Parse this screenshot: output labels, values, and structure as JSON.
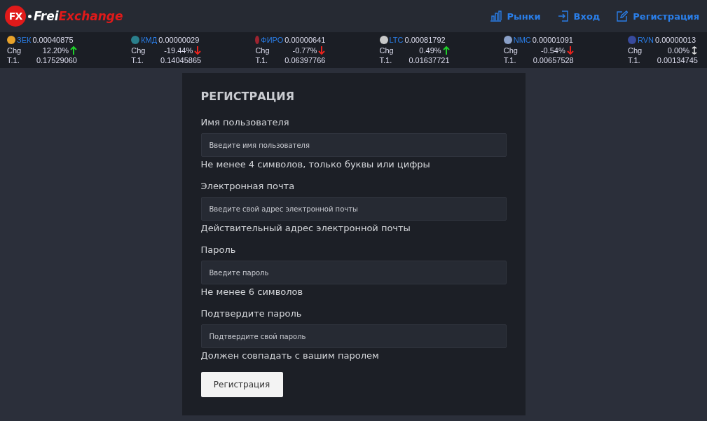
{
  "logo": {
    "badge": "FX",
    "name_first": "Frei",
    "name_second": "Exchange"
  },
  "nav": [
    {
      "label": "Рынки",
      "kind": "chart"
    },
    {
      "label": "Вход",
      "kind": "login"
    },
    {
      "label": "Регистрация",
      "kind": "edit"
    }
  ],
  "ticker": [
    {
      "symbol": "ЗЕК",
      "price": "0.00040875",
      "chg_label": "Chg",
      "chg": "12.20%",
      "kind": "up",
      "t1_label": "T.1.",
      "t1": "0.17529060",
      "color": "#e8a22a"
    },
    {
      "symbol": "КМД",
      "price": "0.00000029",
      "chg_label": "Chg",
      "chg": "-19.44%",
      "kind": "down",
      "t1_label": "T.1.",
      "t1": "0.14045865",
      "color": "#2a7f8c"
    },
    {
      "symbol": "ФИРО",
      "price": "0.00000641",
      "chg_label": "Chg",
      "chg": "-0.77%",
      "kind": "down",
      "t1_label": "T.1.",
      "t1": "0.06397766",
      "color": "#9e2430"
    },
    {
      "symbol": "LTC",
      "price": "0.00081792",
      "chg_label": "Chg",
      "chg": "0.49%",
      "kind": "up",
      "t1_label": "T.1.",
      "t1": "0.01637721",
      "color": "#c8c8c8"
    },
    {
      "symbol": "NMC",
      "price": "0.00001091",
      "chg_label": "Chg",
      "chg": "-0.54%",
      "kind": "down",
      "t1_label": "T.1.",
      "t1": "0.00657528",
      "color": "#8aa0c8"
    },
    {
      "symbol": "RVN",
      "price": "0.00000013",
      "chg_label": "Chg",
      "chg": "0.00%",
      "kind": "flat",
      "t1_label": "T.1.",
      "t1": "0.00134745",
      "color": "#384a9c"
    }
  ],
  "form": {
    "title": "РЕГИСТРАЦИЯ",
    "fields": [
      {
        "label": "Имя пользователя",
        "placeholder": "Введите имя пользователя",
        "hint": "Не менее 4 символов, только буквы или цифры"
      },
      {
        "label": "Электронная почта",
        "placeholder": "Введите свой адрес электронной почты",
        "hint": "Действительный адрес электронной почты"
      },
      {
        "label": "Пароль",
        "placeholder": "Введите пароль",
        "hint": "Не менее 6 символов"
      },
      {
        "label": "Подтвердите пароль",
        "placeholder": "Подтвердите свой пароль",
        "hint": "Должен совпадать с вашим паролем"
      }
    ],
    "submit": "Регистрация"
  }
}
